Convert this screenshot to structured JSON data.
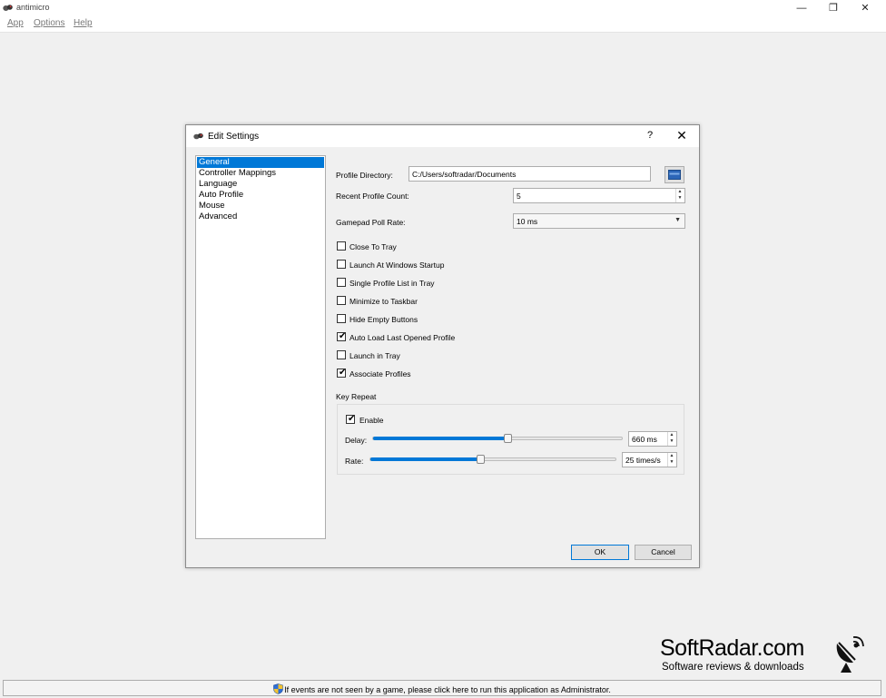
{
  "window": {
    "title": "antimicro",
    "minimize": "—",
    "restore": "❐",
    "close": "✕"
  },
  "menu": [
    "App",
    "Options",
    "Help"
  ],
  "dialog": {
    "title": "Edit Settings",
    "help": "?",
    "close": "✕",
    "categories": [
      "General",
      "Controller Mappings",
      "Language",
      "Auto Profile",
      "Mouse",
      "Advanced"
    ],
    "selected_category": "General",
    "profile_directory": {
      "label": "Profile Directory:",
      "value": "C:/Users/softradar/Documents"
    },
    "recent_profile_count": {
      "label": "Recent Profile Count:",
      "value": "5"
    },
    "gamepad_poll_rate": {
      "label": "Gamepad Poll Rate:",
      "value": "10 ms"
    },
    "checkboxes": [
      {
        "label": "Close To Tray",
        "checked": false
      },
      {
        "label": "Launch At Windows Startup",
        "checked": false
      },
      {
        "label": "Single Profile List in Tray",
        "checked": false
      },
      {
        "label": "Minimize to Taskbar",
        "checked": false
      },
      {
        "label": "Hide Empty Buttons",
        "checked": false
      },
      {
        "label": "Auto Load Last Opened Profile",
        "checked": true
      },
      {
        "label": "Launch in Tray",
        "checked": false
      },
      {
        "label": "Associate Profiles",
        "checked": true
      }
    ],
    "key_repeat": {
      "title": "Key Repeat",
      "enable": {
        "label": "Enable",
        "checked": true
      },
      "delay": {
        "label": "Delay:",
        "value": "660 ms",
        "level": 0.54
      },
      "rate": {
        "label": "Rate:",
        "value": "25 times/s",
        "level": 0.45
      }
    },
    "ok": "OK",
    "cancel": "Cancel",
    "check_mark": "✔"
  },
  "status": {
    "message": "If events are not seen by a game, please click here to run this application as Administrator."
  },
  "watermark": {
    "name": "SoftRadar.com",
    "tagline": "Software reviews & downloads"
  },
  "colors": {
    "accent": "#0078d7",
    "background": "#f0f0f0",
    "uac_blue": "#2f6fd6",
    "uac_yellow": "#f2c230"
  }
}
